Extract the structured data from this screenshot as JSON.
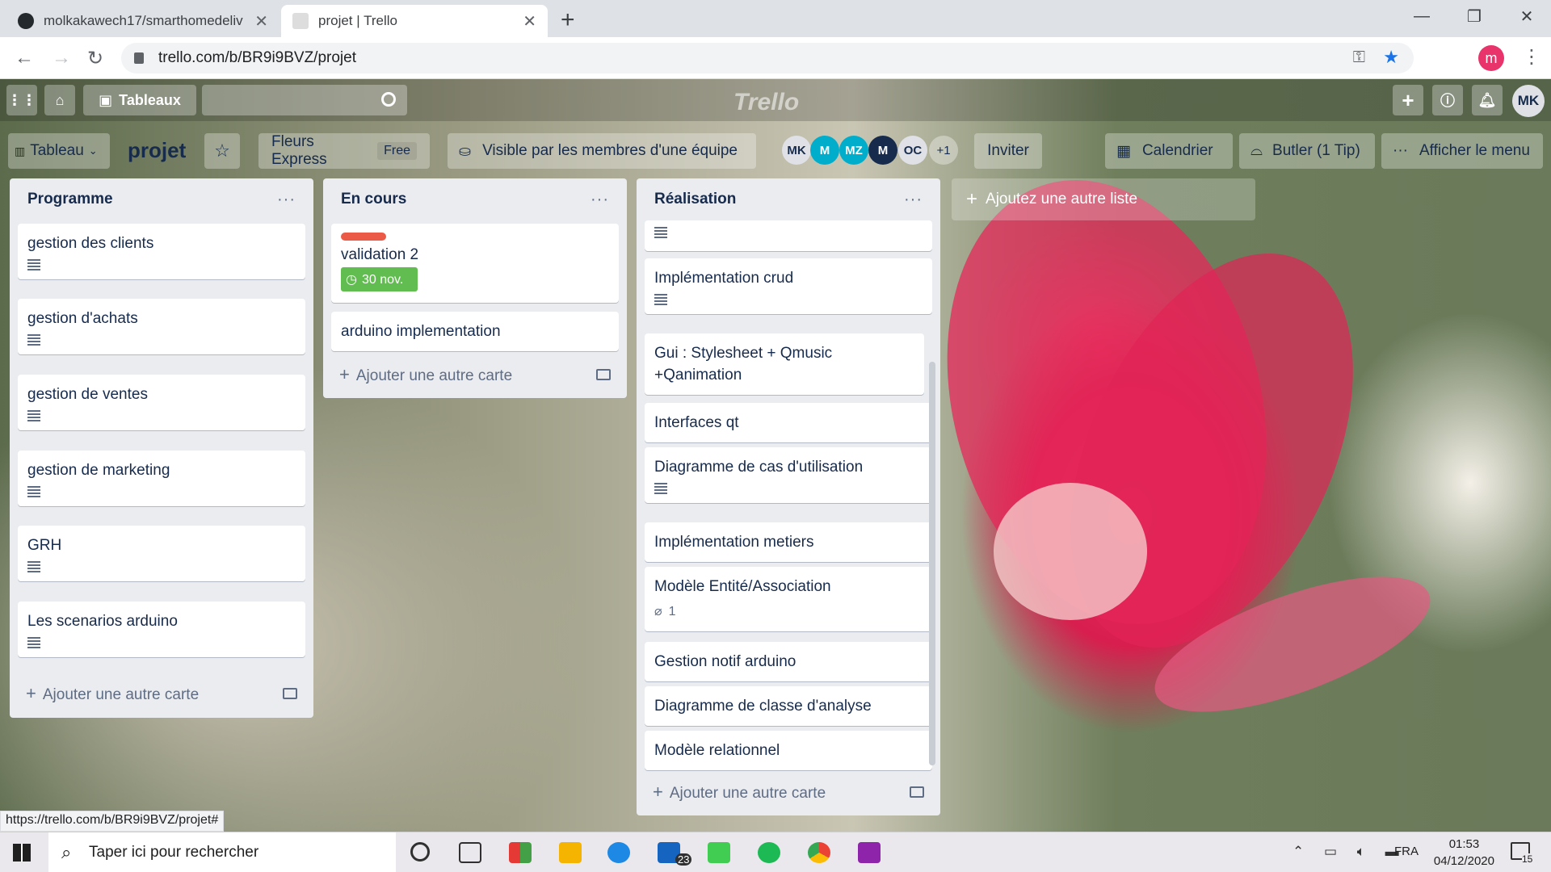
{
  "browser": {
    "tabs": [
      {
        "title": "molkakawech17/smarthomedeliv",
        "active": false
      },
      {
        "title": "projet | Trello",
        "active": true
      }
    ],
    "url": "trello.com/b/BR9i9BVZ/projet",
    "profile_initial": "m"
  },
  "trello": {
    "header": {
      "boards_label": "Tableaux",
      "logo": "Trello",
      "user_initials": "MK"
    },
    "board": {
      "view_label": "Tableau",
      "title": "projet",
      "team": "Fleurs Express",
      "team_badge": "Free",
      "visibility": "Visible par les membres d'une équipe",
      "members": [
        "MK",
        "M",
        "MZ",
        "M",
        "OC"
      ],
      "more_members": "+1",
      "invite": "Inviter",
      "calendar": "Calendrier",
      "butler": "Butler (1 Tip)",
      "menu": "Afficher le menu",
      "add_list": "Ajoutez une autre liste"
    },
    "lists": [
      {
        "title": "Programme",
        "cards": [
          "gestion des clients",
          "gestion d'achats",
          "gestion de ventes",
          "gestion de marketing",
          "GRH",
          "Les scenarios arduino"
        ],
        "add_label": "Ajouter une autre carte"
      },
      {
        "title": "En cours",
        "cards": [
          "validation 2",
          "arduino implementation"
        ],
        "due": "30 nov.",
        "add_label": "Ajouter une autre carte"
      },
      {
        "title": "Réalisation",
        "cards": [
          "Implémentation crud",
          "Gui : Stylesheet + Qmusic +Qanimation",
          "Interfaces qt",
          "Diagramme de cas d'utilisation",
          "Implémentation metiers",
          "Modèle Entité/Association",
          "Gestion notif arduino",
          "Diagramme de classe d'analyse",
          "Modèle relationnel"
        ],
        "attachments": "1",
        "add_label": "Ajouter une autre carte"
      }
    ]
  },
  "status_url": "https://trello.com/b/BR9i9BVZ/projet#",
  "taskbar": {
    "search_placeholder": "Taper ici pour rechercher",
    "lang": "FRA",
    "time": "01:53",
    "date": "04/12/2020",
    "mail_badge": "23",
    "notif_badge": "15"
  },
  "colors": {
    "label_red": "#eb5a46",
    "due_green": "#61bd4f",
    "member_blue": "#00aecc",
    "member_dark": "#172b4d"
  }
}
